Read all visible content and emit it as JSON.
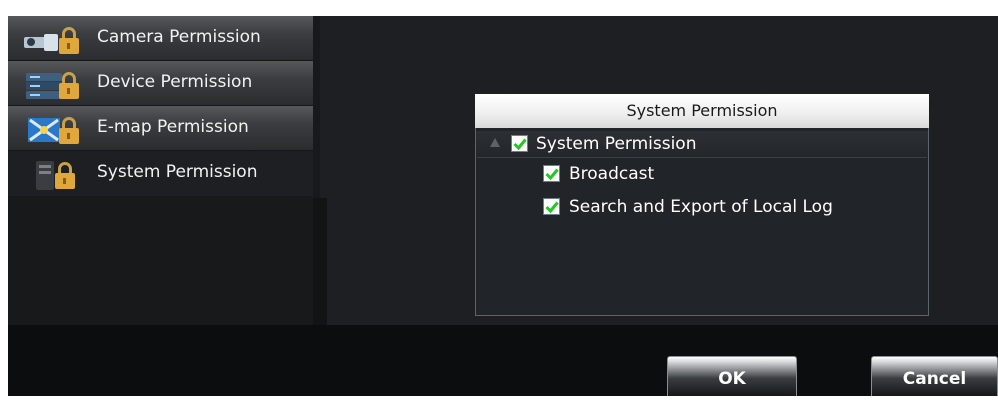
{
  "sidebar": {
    "items": [
      {
        "label": "Camera Permission",
        "icon": "camera-lock-icon"
      },
      {
        "label": "Device Permission",
        "icon": "device-lock-icon"
      },
      {
        "label": "E-map Permission",
        "icon": "emap-lock-icon"
      },
      {
        "label": "System Permission",
        "icon": "system-lock-icon",
        "active": true
      }
    ]
  },
  "panel": {
    "header": "System Permission",
    "tree": {
      "root": {
        "label": "System Permission",
        "checked": true,
        "expanded": true
      },
      "children": [
        {
          "label": "Broadcast",
          "checked": true
        },
        {
          "label": "Search and Export of Local Log",
          "checked": true
        }
      ]
    }
  },
  "footer": {
    "ok_label": "OK",
    "cancel_label": "Cancel"
  },
  "colors": {
    "background": "#1d1f22",
    "check": "#22c81f",
    "header_bg": "#f0f0f0"
  }
}
